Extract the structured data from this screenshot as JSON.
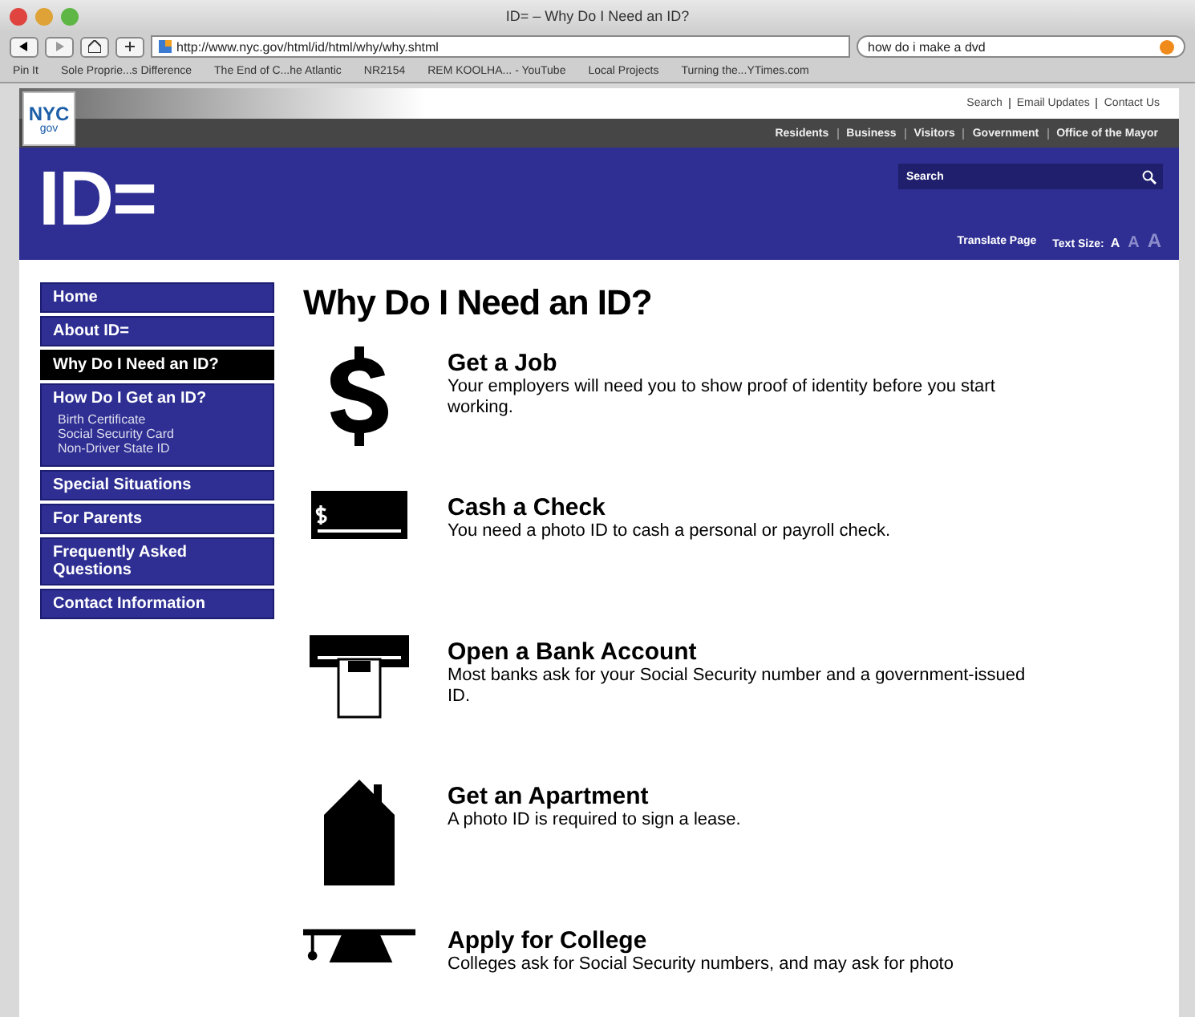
{
  "window": {
    "title": "ID= – Why Do I Need an ID?"
  },
  "browser": {
    "url": "http://www.nyc.gov/html/id/html/why/why.shtml",
    "search_value": "how do i make a dvd",
    "bookmarks": [
      "Pin It",
      "Sole Proprie...s Difference",
      "The End of C...he Atlantic",
      "NR2154",
      "REM KOOLHA... - YouTube",
      "Local Projects",
      "Turning the...YTimes.com"
    ]
  },
  "logo": {
    "line1": "NYC",
    "line2": "gov"
  },
  "utility_links": [
    "Search",
    "Email Updates",
    "Contact Us"
  ],
  "top_nav": [
    "Residents",
    "Business",
    "Visitors",
    "Government",
    "Office of the Mayor"
  ],
  "banner": {
    "title": "ID=",
    "search": {
      "placeholder": "Search"
    },
    "translate": "Translate Page",
    "text_size": {
      "label": "Text Size:",
      "options": [
        {
          "label": "A",
          "selected": true
        },
        {
          "label": "A",
          "selected": false
        },
        {
          "label": "A",
          "selected": false
        }
      ]
    }
  },
  "sidebar": {
    "items": [
      {
        "label": "Home",
        "selected": false
      },
      {
        "label": "About ID=",
        "selected": false
      },
      {
        "label": "Why Do I Need an ID?",
        "selected": true
      },
      {
        "label": "How Do I Get an ID?",
        "selected": false,
        "children": [
          {
            "label": "Birth Certificate"
          },
          {
            "label": "Social Security Card"
          },
          {
            "label": "Non-Driver State ID"
          }
        ]
      },
      {
        "label": "Special Situations",
        "selected": false
      },
      {
        "label": "For Parents",
        "selected": false
      },
      {
        "label": "Frequently Asked Questions",
        "selected": false
      },
      {
        "label": "Contact Information",
        "selected": false
      }
    ]
  },
  "main": {
    "heading": "Why Do I Need an ID?",
    "reasons": [
      {
        "kind": "money",
        "title": "Get a Job",
        "text": "Your employers will need you to show proof of identity before you start working."
      },
      {
        "kind": "check",
        "title": "Cash a Check",
        "text": "You need a photo ID to cash a personal or payroll check."
      },
      {
        "kind": "atm",
        "title": "Open a Bank Account",
        "text": "Most banks ask for your Social Security number and a government-issued ID."
      },
      {
        "kind": "house",
        "title": "Get an Apartment",
        "text": "A photo ID is required to sign a lease."
      },
      {
        "kind": "cap",
        "title": "Apply for College",
        "text": "Colleges ask for Social Security numbers, and may ask for photo"
      }
    ]
  }
}
